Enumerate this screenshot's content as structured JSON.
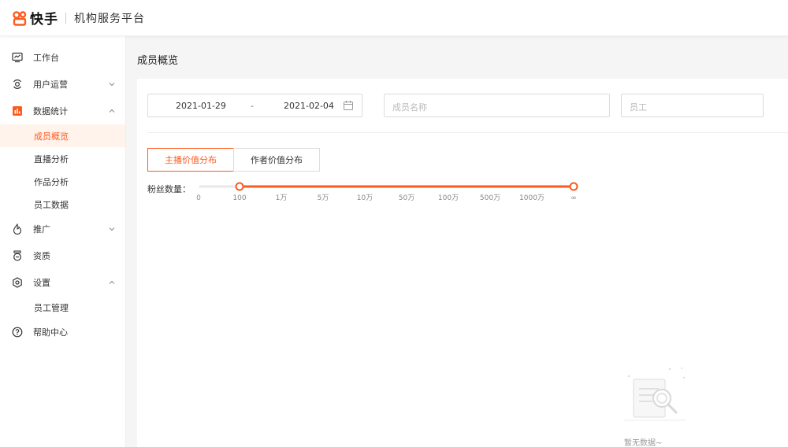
{
  "header": {
    "brand": "快手",
    "platform": "机构服务平台",
    "brand_color": "#fe5a1d"
  },
  "sidebar": {
    "items": [
      {
        "label": "工作台",
        "icon": "dashboard-icon"
      },
      {
        "label": "用户运营",
        "icon": "user-ops-icon",
        "expanded": false
      },
      {
        "label": "数据统计",
        "icon": "stats-icon",
        "expanded": true,
        "children": [
          "成员概览",
          "直播分析",
          "作品分析",
          "员工数据"
        ]
      },
      {
        "label": "推广",
        "icon": "promo-icon",
        "expanded": false
      },
      {
        "label": "资质",
        "icon": "qualification-icon"
      },
      {
        "label": "设置",
        "icon": "settings-icon",
        "expanded": true,
        "children": [
          "员工管理"
        ]
      },
      {
        "label": "帮助中心",
        "icon": "help-icon"
      }
    ],
    "active_child": "成员概览"
  },
  "main": {
    "title": "成员概览",
    "date_start": "2021-01-29",
    "date_sep": "-",
    "date_end": "2021-02-04",
    "member_placeholder": "成员名称",
    "staff_placeholder": "员工",
    "tabs": [
      {
        "label": "主播价值分布",
        "active": true
      },
      {
        "label": "作者价值分布",
        "active": false
      }
    ],
    "fans_label": "粉丝数量：",
    "slider_ticks": [
      "0",
      "100",
      "1万",
      "5万",
      "10万",
      "50万",
      "100万",
      "500万",
      "1000万",
      "∞"
    ],
    "slider_range": [
      "100",
      "∞"
    ],
    "empty_text": "暂无数据~"
  }
}
